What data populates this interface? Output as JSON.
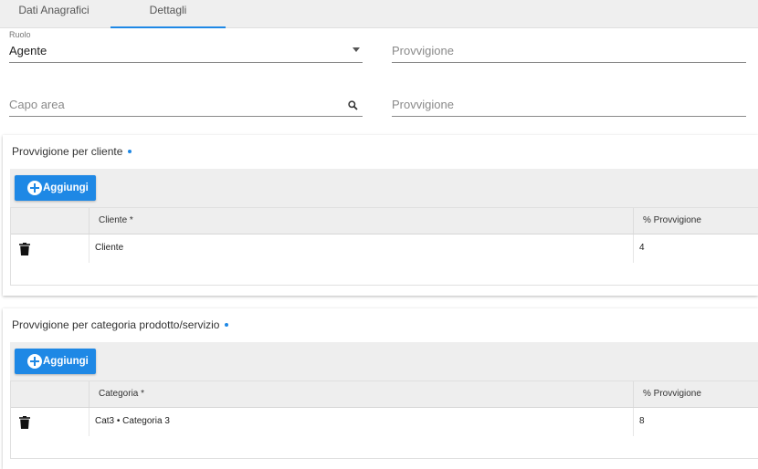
{
  "tabs": [
    {
      "label": "Dati Anagrafici"
    },
    {
      "label": "Dettagli",
      "active": true
    }
  ],
  "form": {
    "ruolo": {
      "label": "Ruolo",
      "value": "Agente"
    },
    "provvigione1": {
      "placeholder": "Provvigione"
    },
    "capo_area": {
      "placeholder": "Capo area"
    },
    "provvigione2": {
      "placeholder": "Provvigione"
    }
  },
  "section_cliente": {
    "title": "Provvigione per cliente",
    "add_label": "Aggiungi",
    "columns": [
      "",
      "Cliente *",
      "% Provvigione"
    ],
    "rows": [
      {
        "name": "Cliente",
        "percent": "4"
      }
    ]
  },
  "section_categoria": {
    "title": "Provvigione per categoria prodotto/servizio",
    "add_label": "Aggiungi",
    "columns": [
      "",
      "Categoria *",
      "% Provvigione"
    ],
    "rows": [
      {
        "name": "Cat3 • Categoria 3",
        "percent": "8"
      }
    ]
  },
  "colors": {
    "accent": "#1e88e5",
    "toolbar_bg": "#eeeeee"
  },
  "icons": [
    "search-icon",
    "chevron-down-icon",
    "add-circle-icon",
    "trash-icon"
  ]
}
